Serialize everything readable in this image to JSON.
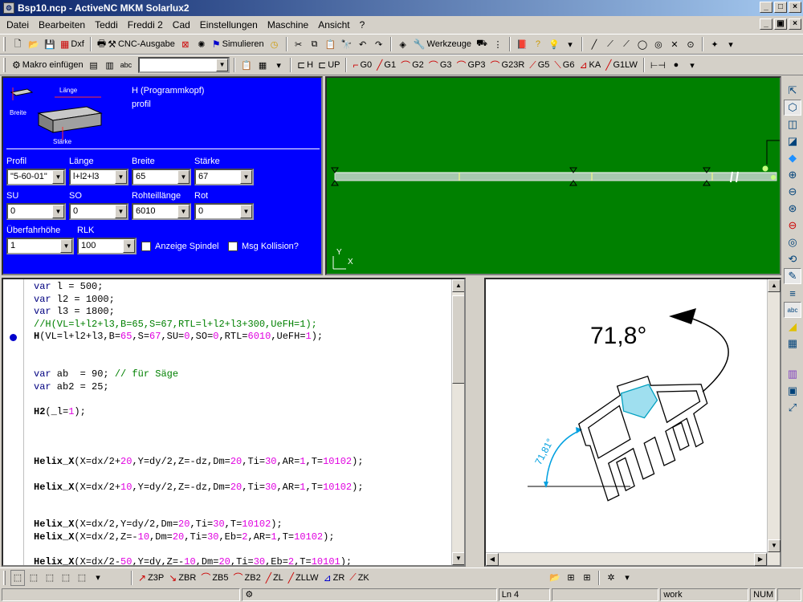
{
  "window": {
    "title": "Bsp10.ncp - ActiveNC MKM Solarlux2",
    "app_icon": "gear-icon",
    "min": "_",
    "max": "□",
    "close": "×"
  },
  "menu": {
    "items": [
      "Datei",
      "Bearbeiten",
      "Teddi",
      "Freddi 2",
      "Cad",
      "Einstellungen",
      "Maschine",
      "Ansicht",
      "?"
    ],
    "mdi_min": "_",
    "mdi_restore": "▣",
    "mdi_close": "×"
  },
  "toolbar1": {
    "dxf": "Dxf",
    "cnc": "CNC-Ausgabe",
    "sim": "Simulieren",
    "werkzeuge": "Werkzeuge"
  },
  "toolbar2": {
    "makro": "Makro einfügen",
    "combo_value": "",
    "buttons": [
      "H",
      "UP",
      "G0",
      "G1",
      "G2",
      "G3",
      "GP3",
      "G23R",
      "G5",
      "G6",
      "KA",
      "G1LW"
    ]
  },
  "params": {
    "illustration_labels": {
      "length": "Länge",
      "width": "Breite",
      "height": "Stärke"
    },
    "header_line1": "H (Programmkopf)",
    "header_line2": "profil",
    "fields": [
      {
        "label": "Profil",
        "value": "\"5-60-01\""
      },
      {
        "label": "Länge",
        "value": "l+l2+l3"
      },
      {
        "label": "Breite",
        "value": "65"
      },
      {
        "label": "Stärke",
        "value": "67"
      },
      {
        "label": "SU",
        "value": "0"
      },
      {
        "label": "SO",
        "value": "0"
      },
      {
        "label": "Rohteillänge",
        "value": "6010"
      },
      {
        "label": "Rot",
        "value": "0"
      },
      {
        "label": "Überfahrhöhe",
        "value": "1"
      },
      {
        "label": "RLK",
        "value": "100"
      }
    ],
    "checkbox1": "Anzeige Spindel",
    "checkbox2": "Msg Kollision?"
  },
  "view3d": {
    "axis_y": "Y",
    "axis_x": "X"
  },
  "code": {
    "lines": [
      "var l = 500;",
      "var l2 = 1000;",
      "var l3 = 1800;",
      "//H(VL=l+l2+l3,B=65,S=67,RTL=l+l2+l3+300,UeFH=1);",
      "H(VL=l+l2+l3,B=65,S=67,SU=0,SO=0,RTL=6010,UeFH=1);",
      "",
      "",
      "var ab  = 90; // für Säge",
      "var ab2 = 25;",
      "",
      "H2(_l=1);",
      "",
      "",
      "",
      "Helix_X(X=dx/2+20,Y=dy/2,Z=-dz,Dm=20,Ti=30,AR=1,T=10102);",
      "",
      "Helix_X(X=dx/2+10,Y=dy/2,Z=-dz,Dm=20,Ti=30,AR=1,T=10102);",
      "",
      "",
      "Helix_X(X=dx/2,Y=dy/2,Dm=20,Ti=30,T=10102);",
      "Helix_X(X=dx/2,Z=-10,Dm=20,Ti=30,Eb=2,AR=1,T=10102);",
      "",
      "Helix_X(X=dx/2-50,Y=dy,Z=-10,Dm=20,Ti=30,Eb=2,T=10101);"
    ]
  },
  "drawing": {
    "angle_big": "71,8°",
    "angle_small": "71,81°"
  },
  "bottom_toolbar": {
    "buttons": [
      "Z3P",
      "ZBR",
      "ZB5",
      "ZB2",
      "ZL",
      "ZLLW",
      "ZR",
      "ZK"
    ]
  },
  "status": {
    "line": "Ln 4",
    "mode": "work",
    "num": "NUM"
  },
  "colors": {
    "blue_panel": "#0000ff",
    "green_view": "#008000",
    "title_start": "#0a246a"
  }
}
